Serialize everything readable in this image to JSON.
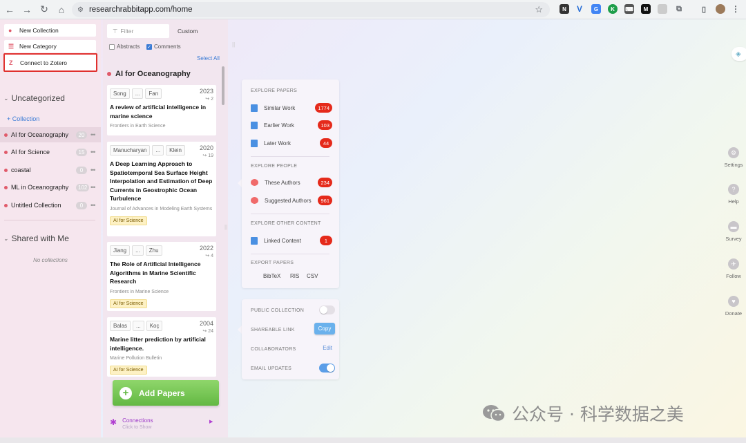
{
  "browser": {
    "url": "researchrabbitapp.com/home",
    "nav": {
      "back": "←",
      "forward": "→",
      "reload": "↻",
      "home": "⌂"
    },
    "bookmark_icon": "star-icon"
  },
  "left": {
    "menu": {
      "new_collection": "New Collection",
      "new_category": "New Category",
      "connect_zotero": "Connect to Zotero"
    },
    "uncategorized": "Uncategorized",
    "add_collection": "+ Collection",
    "collections": [
      {
        "name": "AI for Oceanography",
        "count": "20",
        "active": true
      },
      {
        "name": "AI for Science",
        "count": "15",
        "active": false
      },
      {
        "name": "coastal",
        "count": "0",
        "active": false
      },
      {
        "name": "ML in Oceanography",
        "count": "102",
        "active": false
      },
      {
        "name": "Untitled Collection",
        "count": "0",
        "active": false
      }
    ],
    "shared_title": "Shared with Me",
    "no_collections": "No collections"
  },
  "middle": {
    "filter_placeholder": "Filter",
    "custom": "Custom",
    "abstracts": "Abstracts",
    "comments": "Comments",
    "select_all": "Select All",
    "collection_title": "AI for Oceanography",
    "papers": [
      {
        "a1": "Song",
        "a2": "...",
        "a3": "Fan",
        "year": "2023",
        "cites": "↪ 2",
        "title": "A review of artificial intelligence in marine science",
        "journal": "Frontiers in Earth Science",
        "tag": ""
      },
      {
        "a1": "Manucharyan",
        "a2": "...",
        "a3": "Klein",
        "year": "2020",
        "cites": "↪ 19",
        "title": "A Deep Learning Approach to Spatiotemporal Sea Surface Height Interpolation and Estimation of Deep Currents in Geostrophic Ocean Turbulence",
        "journal": "Journal of Advances in Modeling Earth Systems",
        "tag": "AI for Science"
      },
      {
        "a1": "Jiang",
        "a2": "...",
        "a3": "Zhu",
        "year": "2022",
        "cites": "↪ 4",
        "title": "The Role of Artificial Intelligence Algorithms in Marine Scientific Research",
        "journal": "Frontiers in Marine Science",
        "tag": "AI for Science"
      },
      {
        "a1": "Balas",
        "a2": "...",
        "a3": "Koç",
        "year": "2004",
        "cites": "↪ 24",
        "title": "Marine litter prediction by artificial intelligence.",
        "journal": "Marine Pollution Bulletin",
        "tag": "AI for Science"
      }
    ],
    "add_papers": "Add Papers",
    "connections": "Connections",
    "click_to_show": "Click to Show"
  },
  "explore": {
    "papers_header": "EXPLORE PAPERS",
    "similar": "Similar Work",
    "similar_count": "1774",
    "earlier": "Earlier Work",
    "earlier_count": "103",
    "later": "Later Work",
    "later_count": "44",
    "people_header": "EXPLORE PEOPLE",
    "these_authors": "These Authors",
    "these_count": "234",
    "suggested": "Suggested Authors",
    "suggested_count": "961",
    "other_header": "EXPLORE OTHER CONTENT",
    "linked": "Linked Content",
    "linked_count": "1",
    "export_header": "EXPORT PAPERS",
    "bibtex": "BibTeX",
    "ris": "RIS",
    "csv": "CSV"
  },
  "share": {
    "public": "PUBLIC COLLECTION",
    "link": "SHAREABLE LINK",
    "copy": "Copy",
    "collaborators": "COLLABORATORS",
    "edit": "Edit",
    "email": "EMAIL UPDATES",
    "public_on": false,
    "email_on": true
  },
  "rightbar": {
    "settings": "Settings",
    "help": "Help",
    "survey": "Survey",
    "follow": "Follow",
    "donate": "Donate"
  },
  "watermark": "公众号 · 科学数据之美",
  "colors": {
    "accent_red": "#e05a6a",
    "badge_red": "#e52a1b",
    "link_blue": "#3a7bd5",
    "add_green": "#63b843",
    "zotero_border": "#e0302e"
  }
}
